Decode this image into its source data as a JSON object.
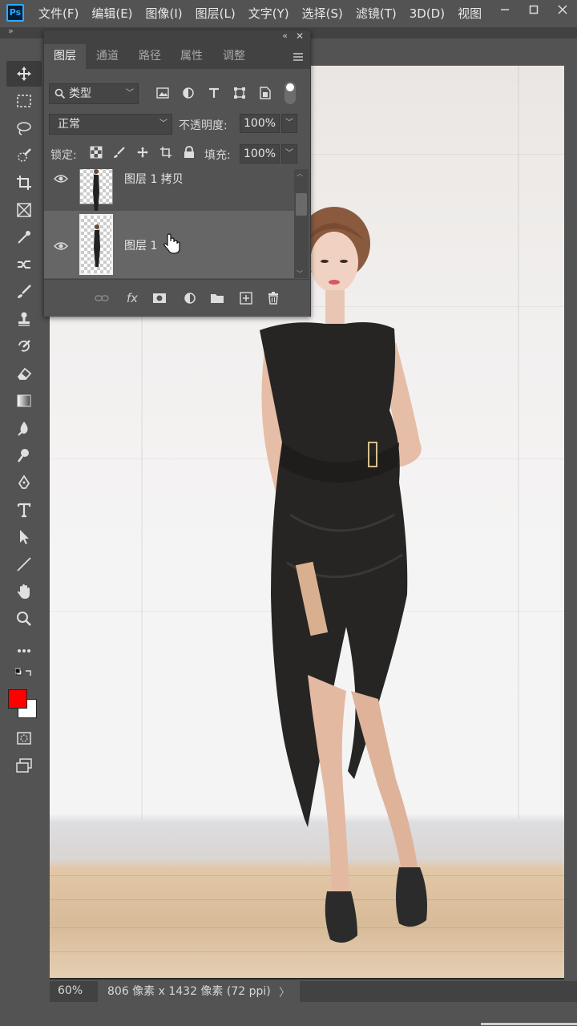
{
  "app": {
    "logo": "Ps"
  },
  "menu": [
    "文件(F)",
    "编辑(E)",
    "图像(I)",
    "图层(L)",
    "文字(Y)",
    "选择(S)",
    "滤镜(T)",
    "3D(D)",
    "视图"
  ],
  "window_controls": [
    "minimize-icon",
    "maximize-icon",
    "close-icon"
  ],
  "tools": [
    "move-tool",
    "marquee-tool",
    "lasso-tool",
    "quick-select-tool",
    "crop-tool",
    "frame-tool",
    "eyedropper-tool",
    "healing-tool",
    "brush-tool",
    "stamp-tool",
    "history-brush-tool",
    "eraser-tool",
    "gradient-tool",
    "blur-tool",
    "dodge-tool",
    "pen-tool",
    "type-tool",
    "path-select-tool",
    "line-tool",
    "hand-tool",
    "zoom-tool",
    "more-tools"
  ],
  "colors": {
    "foreground": "#ff0000",
    "background": "#ffffff"
  },
  "layers_panel": {
    "tabs": [
      "图层",
      "通道",
      "路径",
      "属性",
      "调整"
    ],
    "active_tab": "图层",
    "filter_kind": "类型",
    "blend_mode": "正常",
    "opacity_label": "不透明度:",
    "opacity_value": "100%",
    "lock_label": "锁定:",
    "fill_label": "填充:",
    "fill_value": "100%",
    "layers": [
      {
        "name": "图层 1 拷贝",
        "visible": true,
        "selected": false
      },
      {
        "name": "图层 1",
        "visible": true,
        "selected": true
      }
    ]
  },
  "status": {
    "zoom": "60%",
    "doc_size": "806 像素 x 1432 像素 (72 ppi)",
    "arrow": "〉"
  }
}
